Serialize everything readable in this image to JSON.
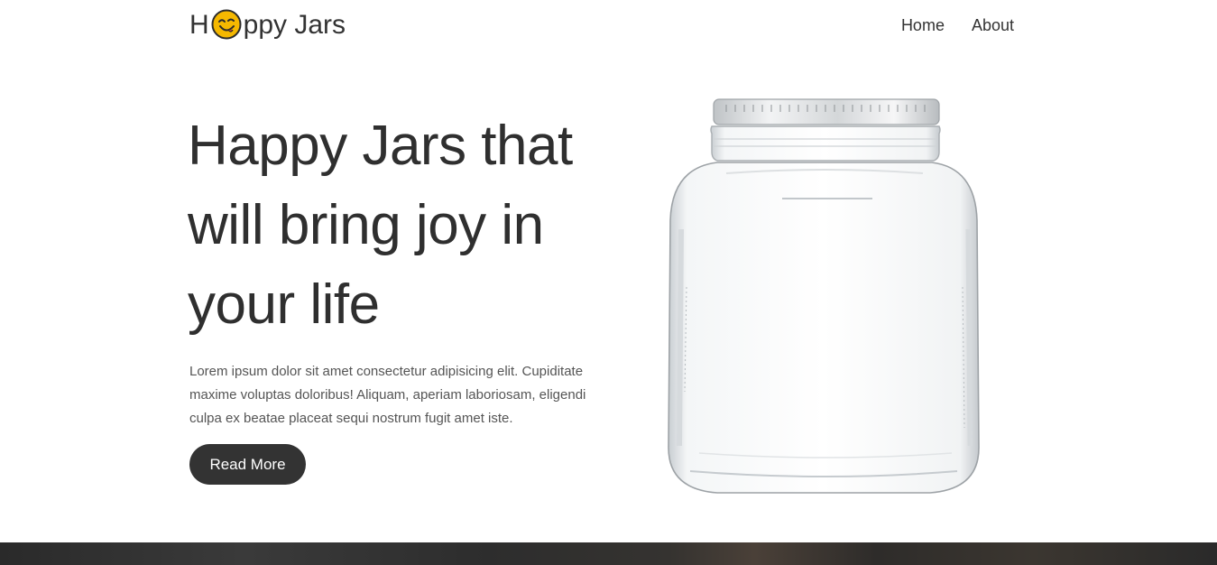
{
  "header": {
    "logo_prefix": "H",
    "logo_suffix": "ppy Jars",
    "logo_icon": "smiling-face-icon",
    "nav": [
      {
        "label": "Home"
      },
      {
        "label": "About"
      }
    ]
  },
  "hero": {
    "title": "Happy Jars that will bring joy in your life",
    "text": "Lorem ipsum dolor sit amet consectetur adipisicing elit. Cupiditate maxime voluptas doloribus! Aliquam, aperiam laboriosam, eligendi culpa ex beatae placeat sequi nostrum fugit amet iste.",
    "button_label": "Read More",
    "image": "glass-jar-image"
  },
  "colors": {
    "text": "#333333",
    "button_bg": "#333333",
    "button_text": "#ffffff",
    "logo_icon": "#f5b800"
  }
}
